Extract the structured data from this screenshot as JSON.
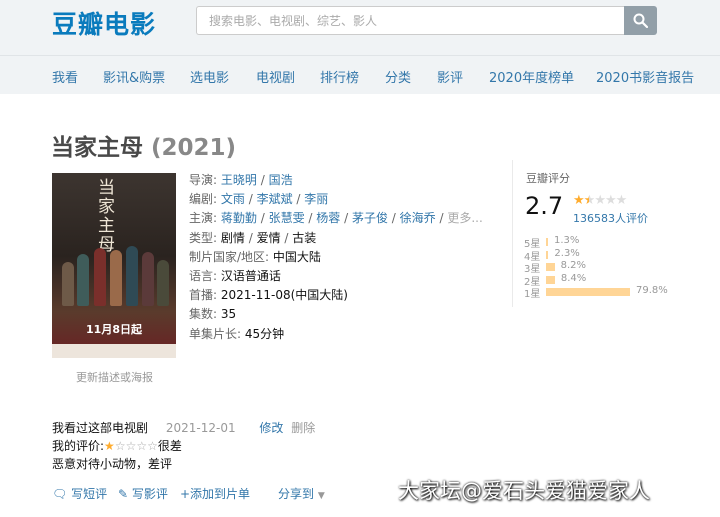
{
  "header": {
    "logo": "豆瓣电影",
    "search_placeholder": "搜索电影、电视剧、综艺、影人",
    "nav": [
      "我看",
      "影讯&购票",
      "选电影",
      "电视剧",
      "排行榜",
      "分类",
      "影评",
      "2020年度榜单",
      "2020书影音报告"
    ]
  },
  "subject": {
    "title": "当家主母",
    "year": "(2021)",
    "poster_title": "当家主母",
    "poster_date": "11月8日起",
    "update_link": "更新描述或海报",
    "info": {
      "director_label": "导演:",
      "directors": [
        "王晓明",
        "国浩"
      ],
      "writer_label": "编剧:",
      "writers": [
        "文雨",
        "李斌斌",
        "李丽"
      ],
      "cast_label": "主演:",
      "cast": [
        "蒋勤勤",
        "张慧雯",
        "杨蓉",
        "茅子俊",
        "徐海乔"
      ],
      "cast_more": "更多...",
      "genre_label": "类型:",
      "genres": [
        "剧情",
        "爱情",
        "古装"
      ],
      "region_label": "制片国家/地区:",
      "region": "中国大陆",
      "language_label": "语言:",
      "language": "汉语普通话",
      "premiere_label": "首播:",
      "premiere": "2021-11-08(中国大陆)",
      "episodes_label": "集数:",
      "episodes": "35",
      "runtime_label": "单集片长:",
      "runtime": "45分钟"
    }
  },
  "rating": {
    "title": "豆瓣评分",
    "score": "2.7",
    "stars_value": 1.5,
    "count_text": "136583人评价",
    "breakdown": [
      {
        "label": "5星",
        "pct_text": "1.3%",
        "pct": 1.3
      },
      {
        "label": "4星",
        "pct_text": "2.3%",
        "pct": 2.3
      },
      {
        "label": "3星",
        "pct_text": "8.2%",
        "pct": 8.2
      },
      {
        "label": "2星",
        "pct_text": "8.4%",
        "pct": 8.4
      },
      {
        "label": "1星",
        "pct_text": "79.8%",
        "pct": 79.8
      }
    ],
    "star_color": "#ffac2d",
    "bar_color": "#ffd596"
  },
  "my": {
    "watched_text": "我看过这部电视剧",
    "date": "2021-12-01",
    "edit": "修改",
    "delete": "删除",
    "my_rating_label": "我的评价:",
    "my_stars_value": 1,
    "my_rating_word": "很差",
    "comment": "恶意对待小动物，差评"
  },
  "actions": {
    "short_review": "写短评",
    "review": "写影评",
    "add_list": "+添加到片单",
    "share": "分享到"
  },
  "watermark": "大家坛@爱石头爱猫爱家人"
}
